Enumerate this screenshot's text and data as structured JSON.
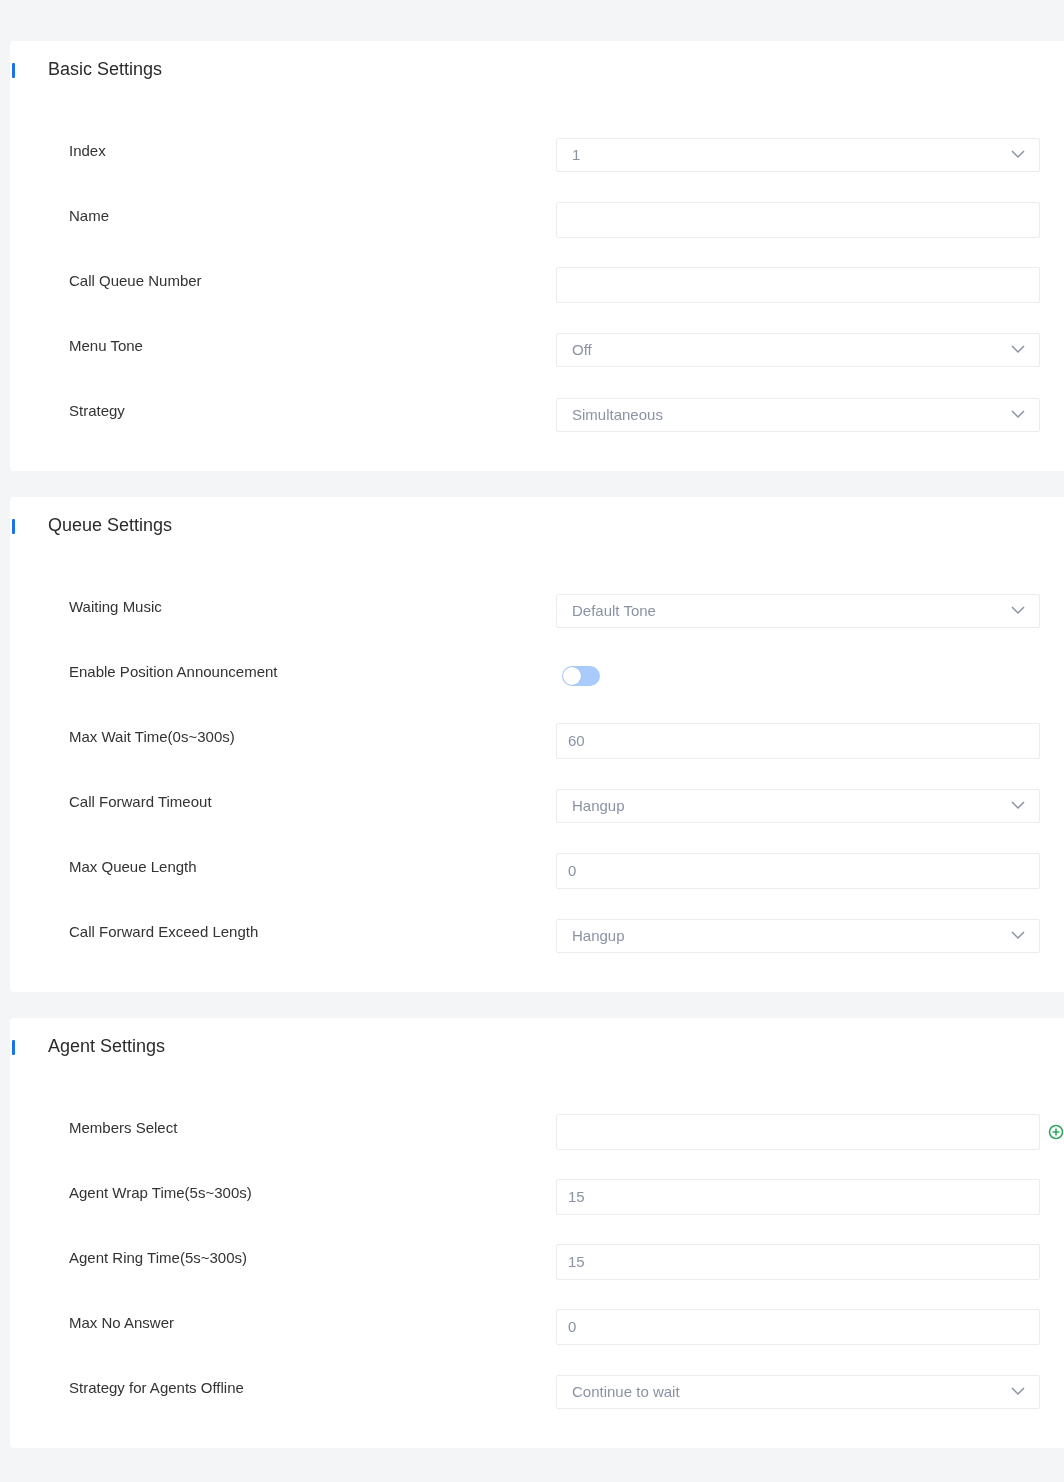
{
  "sections": [
    {
      "title": "Basic Settings",
      "fields": [
        {
          "label": "Index",
          "kind": "select",
          "value": "1"
        },
        {
          "label": "Name",
          "kind": "input"
        },
        {
          "label": "Call Queue Number",
          "kind": "input"
        },
        {
          "label": "Menu Tone",
          "kind": "select",
          "value": "Off"
        },
        {
          "label": "Strategy",
          "kind": "select",
          "value": "Simultaneous"
        }
      ]
    },
    {
      "title": "Queue Settings",
      "fields": [
        {
          "label": "Waiting Music",
          "kind": "select",
          "value": "Default Tone"
        },
        {
          "label": "Enable Position Announcement",
          "kind": "toggle",
          "on": false
        },
        {
          "label": "Max Wait Time(0s~300s)",
          "kind": "input",
          "value": "60"
        },
        {
          "label": "Call Forward Timeout",
          "kind": "select",
          "value": "Hangup"
        },
        {
          "label": "Max Queue Length",
          "kind": "input",
          "value": "0"
        },
        {
          "label": "Call Forward Exceed Length",
          "kind": "select",
          "value": "Hangup"
        }
      ]
    },
    {
      "title": "Agent Settings",
      "fields": [
        {
          "label": "Members Select",
          "kind": "input",
          "add": true
        },
        {
          "label": "Agent Wrap Time(5s~300s)",
          "kind": "input",
          "value": "15"
        },
        {
          "label": "Agent Ring Time(5s~300s)",
          "kind": "input",
          "value": "15"
        },
        {
          "label": "Max No Answer",
          "kind": "input",
          "value": "0"
        },
        {
          "label": "Strategy for Agents Offline",
          "kind": "select",
          "value": "Continue to wait"
        }
      ]
    }
  ]
}
